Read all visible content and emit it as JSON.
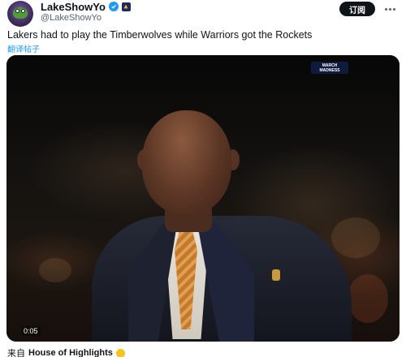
{
  "author": {
    "display_name": "LakeShowYo",
    "handle": "@LakeShowYo",
    "verified_icon": "verified-check-icon",
    "affiliate_icon": "affiliate-badge-icon"
  },
  "actions": {
    "subscribe_label": "订阅",
    "more_icon": "more-horizontal-icon"
  },
  "tweet": {
    "text": "Lakers had to play the Timberwolves while Warriors got the Rockets",
    "translate_label": "翻译帖子"
  },
  "media": {
    "watermark_line1": "MARCH",
    "watermark_line2": "MADNESS",
    "duration": "0:05"
  },
  "source": {
    "prefix": "来自",
    "channel": "House of Highlights",
    "badge_icon": "gold-badge-icon"
  },
  "colors": {
    "accent": "#1d9bf0",
    "text": "#0f1419",
    "secondary": "#536471",
    "button_bg": "#0f1419"
  }
}
